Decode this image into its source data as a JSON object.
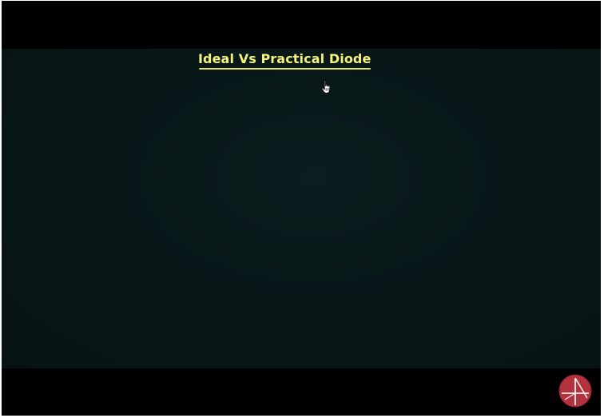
{
  "video": {
    "board": {
      "title": "Ideal Vs Practical Diode",
      "title_color": "#f6f27a",
      "background_color": "#081819"
    },
    "pointer": {
      "icon": "hand-pointer-icon"
    },
    "watermark": {
      "icon": "channel-logo-icon",
      "color": "#b3323e"
    }
  }
}
